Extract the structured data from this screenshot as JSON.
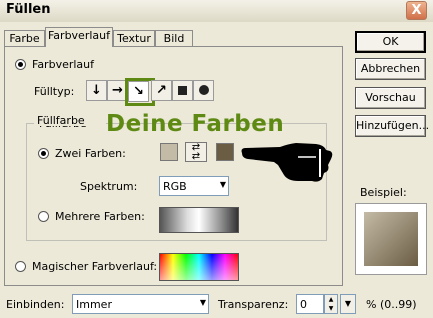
{
  "window": {
    "title": "Füllen",
    "close_glyph": "X"
  },
  "tabs": [
    {
      "label": "Farbe"
    },
    {
      "label": "Farbverlauf",
      "active": true
    },
    {
      "label": "Textur"
    },
    {
      "label": "Bild"
    }
  ],
  "buttons": {
    "ok": "OK",
    "abbrechen": "Abbrechen",
    "vorschau": "Vorschau",
    "hinzufuegen": "Hinzufügen..."
  },
  "farbverlauf": {
    "label": "Farbverlauf",
    "selected": true,
    "fuelltyp_label": "Fülltyp:",
    "fuelltyp_selected": "diagonal-arrow",
    "fuelltyp_icons": [
      "arrow-down-icon",
      "arrow-right-icon",
      "arrow-down-right-icon",
      "arrow-up-right-icon",
      "square-icon",
      "circle-icon"
    ]
  },
  "fuellfarbe": {
    "group_label": "Füllfarbe",
    "zwei_farben_label": "Zwei Farben:",
    "zwei_farben_selected": true,
    "color1": "#c4bba6",
    "color2": "#6b5d44",
    "spektrum_label": "Spektrum:",
    "spektrum_value": "RGB",
    "mehrere_farben_label": "Mehrere Farben:"
  },
  "magisch_label": "Magischer Farbverlauf:",
  "annotation": {
    "text": "Deine Farben",
    "color": "#5e8a14"
  },
  "beispiel_label": "Beispiel:",
  "bottom": {
    "einbinden_label": "Einbinden:",
    "einbinden_value": "Immer",
    "transparenz_label": "Transparenz:",
    "transparenz_value": "0",
    "range_text": "% (0..99)"
  }
}
